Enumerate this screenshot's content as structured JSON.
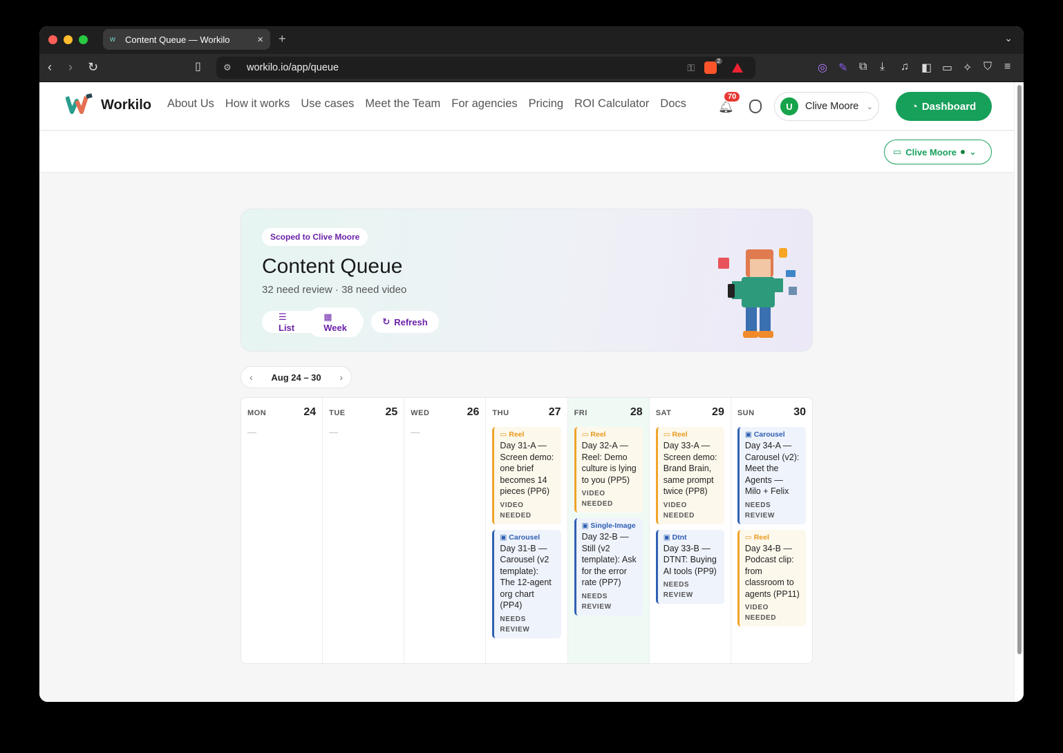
{
  "browser": {
    "tab_title": "Content Queue — Workilo",
    "tab_close": "×",
    "new_tab": "+",
    "url": "workilo.io/app/queue",
    "brave_badge": "2"
  },
  "nav": {
    "brand": "Workilo",
    "links": [
      "About Us",
      "How it works",
      "Use cases",
      "Meet the Team",
      "For agencies",
      "Pricing",
      "ROI Calculator",
      "Docs"
    ],
    "notifications_count": "70",
    "user_initial": "U",
    "user_name": "Clive Moore",
    "dashboard_label": "Dashboard"
  },
  "workspace": {
    "name": "Clive Moore"
  },
  "hero": {
    "scope_badge": "Scoped to Clive Moore",
    "title": "Content Queue",
    "subtitle": "32 need review · 38 need video",
    "view_list": "List",
    "view_week": "Week",
    "refresh": "Refresh"
  },
  "week": {
    "range": "Aug 24 – 30"
  },
  "colors": {
    "brand_green": "#16a05a",
    "accent_purple": "#6b21a8",
    "reel_orange": "#f0a42a",
    "review_blue": "#2f5fb3",
    "notification_red": "#e53935"
  },
  "days": [
    {
      "name": "MON",
      "num": "24",
      "empty": "—",
      "cards": []
    },
    {
      "name": "TUE",
      "num": "25",
      "empty": "—",
      "cards": []
    },
    {
      "name": "WED",
      "num": "26",
      "empty": "—",
      "cards": []
    },
    {
      "name": "THU",
      "num": "27",
      "cards": [
        {
          "kind": "reel",
          "icon": "clapper-icon",
          "type": "Reel",
          "title": "Day 31-A — Screen demo: one brief becomes 14 pieces (PP6)",
          "status": "VIDEO NEEDED"
        },
        {
          "kind": "blue",
          "icon": "carousel-icon",
          "type": "Carousel",
          "title": "Day 31-B — Carousel (v2 template): The 12-agent org chart (PP4)",
          "status": "NEEDS REVIEW"
        }
      ]
    },
    {
      "name": "FRI",
      "num": "28",
      "today": true,
      "cards": [
        {
          "kind": "reel",
          "icon": "clapper-icon",
          "type": "Reel",
          "title": "Day 32-A — Reel: Demo culture is lying to you (PP5)",
          "status": "VIDEO NEEDED"
        },
        {
          "kind": "blue",
          "icon": "megaphone-icon",
          "type": "Single-Image",
          "title": "Day 32-B — Still (v2 template): Ask for the error rate (PP7)",
          "status": "NEEDS REVIEW"
        }
      ]
    },
    {
      "name": "SAT",
      "num": "29",
      "cards": [
        {
          "kind": "reel",
          "icon": "clapper-icon",
          "type": "Reel",
          "title": "Day 33-A — Screen demo: Brand Brain, same prompt twice (PP8)",
          "status": "VIDEO NEEDED"
        },
        {
          "kind": "blue",
          "icon": "megaphone-icon",
          "type": "Dtnt",
          "title": "Day 33-B — DTNT: Buying AI tools (PP9)",
          "status": "NEEDS REVIEW"
        }
      ]
    },
    {
      "name": "SUN",
      "num": "30",
      "cards": [
        {
          "kind": "blue",
          "icon": "carousel-icon",
          "type": "Carousel",
          "title": "Day 34-A — Carousel (v2): Meet the Agents — Milo + Felix",
          "status": "NEEDS REVIEW"
        },
        {
          "kind": "reel",
          "icon": "clapper-icon",
          "type": "Reel",
          "title": "Day 34-B — Podcast clip: from classroom to agents (PP11)",
          "status": "VIDEO NEEDED"
        }
      ]
    }
  ]
}
